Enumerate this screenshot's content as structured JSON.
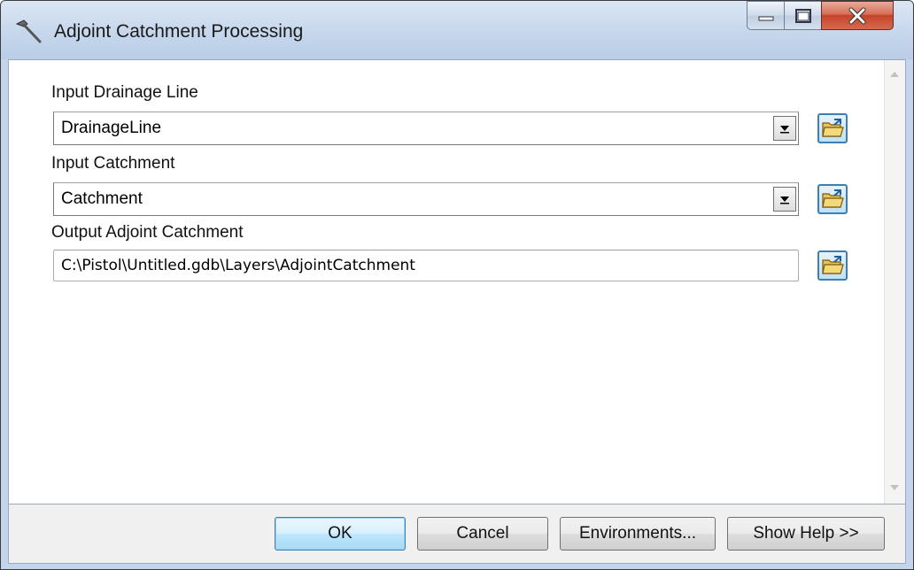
{
  "window": {
    "title": "Adjoint Catchment Processing",
    "icon": "hammer-icon",
    "caption_buttons": [
      "minimize-icon",
      "maximize-icon",
      "close-icon"
    ]
  },
  "form": {
    "drainage_line": {
      "label": "Input Drainage Line",
      "value": "DrainageLine"
    },
    "catchment": {
      "label": "Input Catchment",
      "value": "Catchment"
    },
    "output": {
      "label": "Output Adjoint Catchment",
      "value": "C:\\Pistol\\Untitled.gdb\\Layers\\AdjointCatchment"
    }
  },
  "buttons": {
    "ok": "OK",
    "cancel": "Cancel",
    "environments": "Environments...",
    "show_help": "Show Help >>"
  },
  "colors": {
    "title_bar": "#c6d7ec",
    "close_button": "#c4432a",
    "default_button_border": "#3c7fb1"
  }
}
